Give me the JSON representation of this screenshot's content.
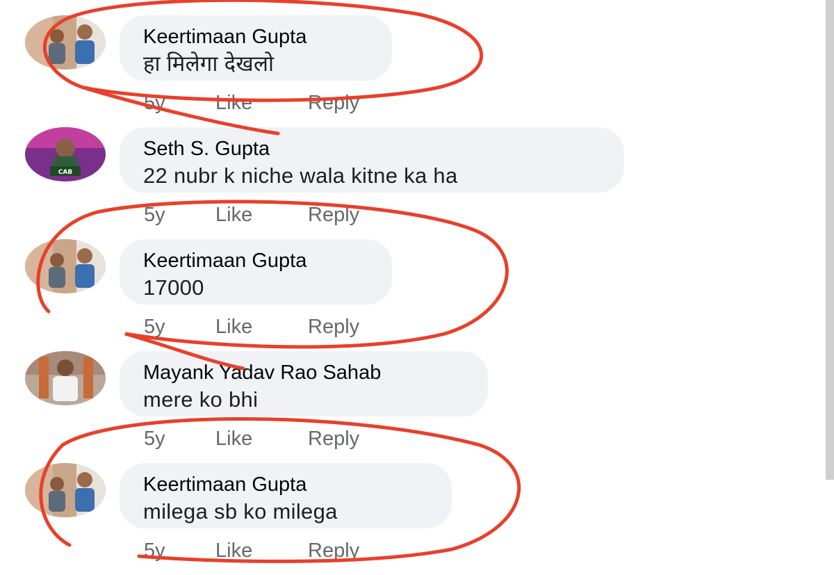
{
  "comments": [
    {
      "author": "Keertimaan Gupta",
      "text": "हा मिलेगा देखलो",
      "time": "5y",
      "like": "Like",
      "reply": "Reply",
      "avatar": "profile-photo"
    },
    {
      "author": "Seth S. Gupta",
      "text": "22 nubr k niche wala kitne ka ha",
      "time": "5y",
      "like": "Like",
      "reply": "Reply",
      "avatar": "profile-photo",
      "avatar_caption": "CAB"
    },
    {
      "author": "Keertimaan Gupta",
      "text": "17000",
      "time": "5y",
      "like": "Like",
      "reply": "Reply",
      "avatar": "profile-photo"
    },
    {
      "author": "Mayank Yadav Rao Sahab",
      "text": "mere ko bhi",
      "time": "5y",
      "like": "Like",
      "reply": "Reply",
      "avatar": "profile-photo"
    },
    {
      "author": "Keertimaan Gupta",
      "text": "milega sb ko milega",
      "time": "5y",
      "like": "Like",
      "reply": "Reply",
      "avatar": "profile-photo"
    }
  ],
  "colors": {
    "bubble": "#f0f2f5",
    "author_text": "#050505",
    "meta_text": "#65676b",
    "annotation": "#e8402a"
  }
}
